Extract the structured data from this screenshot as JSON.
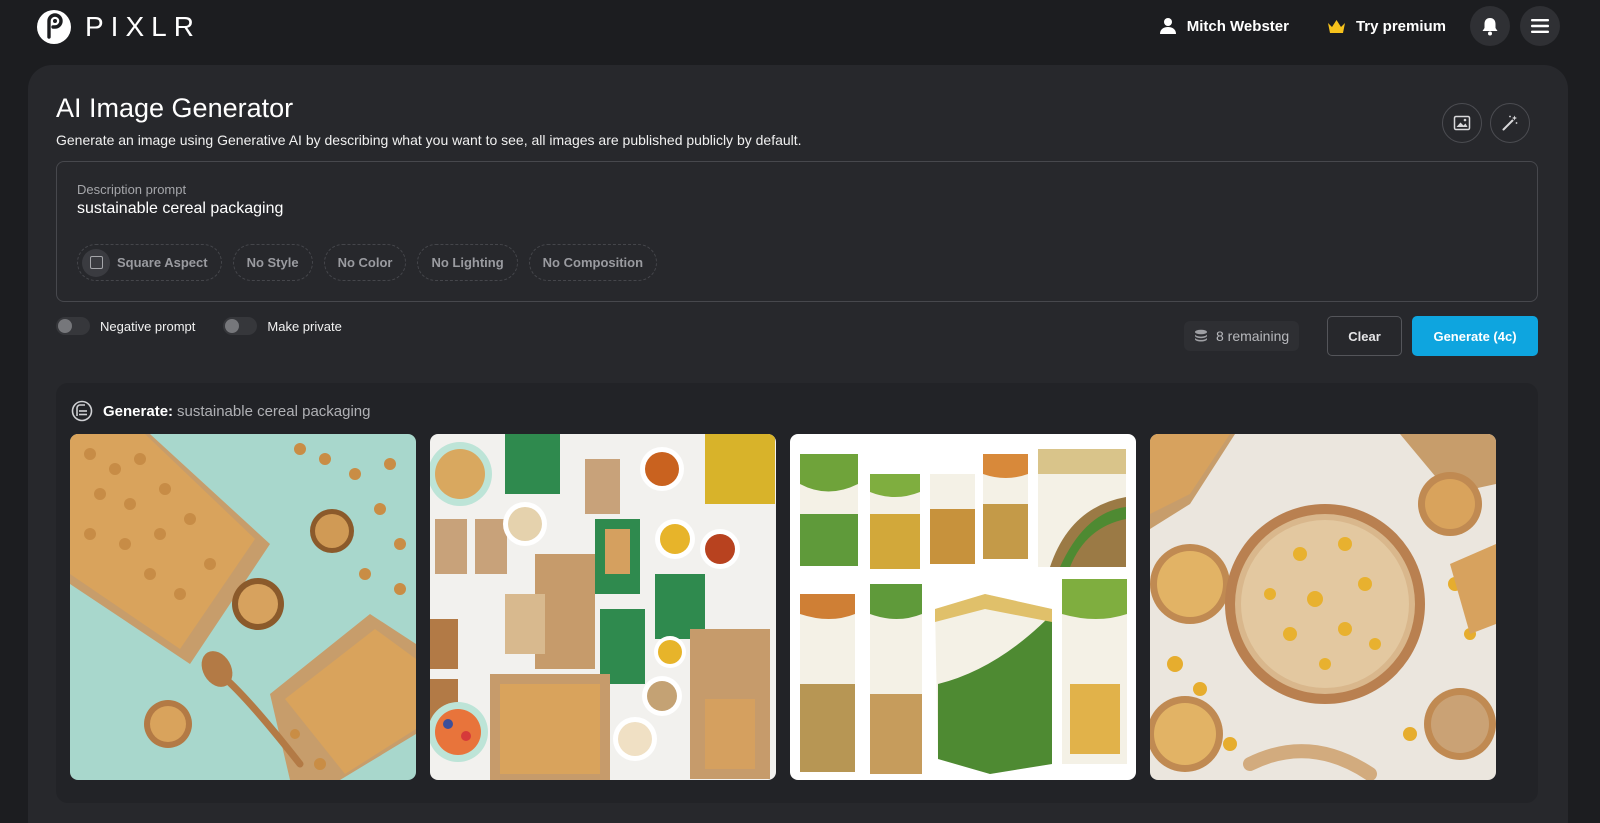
{
  "header": {
    "logo_text": "PIXLR",
    "user_name": "Mitch Webster",
    "premium_label": "Try premium",
    "icons": [
      "user-icon",
      "crown-icon",
      "bell-icon",
      "menu-icon"
    ]
  },
  "page": {
    "title": "AI Image Generator",
    "subtitle": "Generate an image using Generative AI by describing what you want to see, all images are published publicly by default."
  },
  "prompt": {
    "label": "Description prompt",
    "value": "sustainable cereal packaging"
  },
  "chips": [
    "Square Aspect",
    "No Style",
    "No Color",
    "No Lighting",
    "No Composition"
  ],
  "toggles": {
    "negative_prompt": "Negative prompt",
    "make_private": "Make private"
  },
  "actions": {
    "remaining": "8 remaining",
    "clear": "Clear",
    "generate": "Generate (4c)"
  },
  "results": {
    "label": "Generate:",
    "prompt": "sustainable cereal packaging",
    "images": [
      "cereal-boxes-on-mint-background",
      "cereal-packaging-flatlay",
      "green-cereal-box-mockups",
      "cereal-bowl-top-view"
    ]
  },
  "colors": {
    "background": "#1c1d20",
    "panel": "#27282c",
    "accent": "#0ea5df",
    "crown": "#f6c21c"
  }
}
